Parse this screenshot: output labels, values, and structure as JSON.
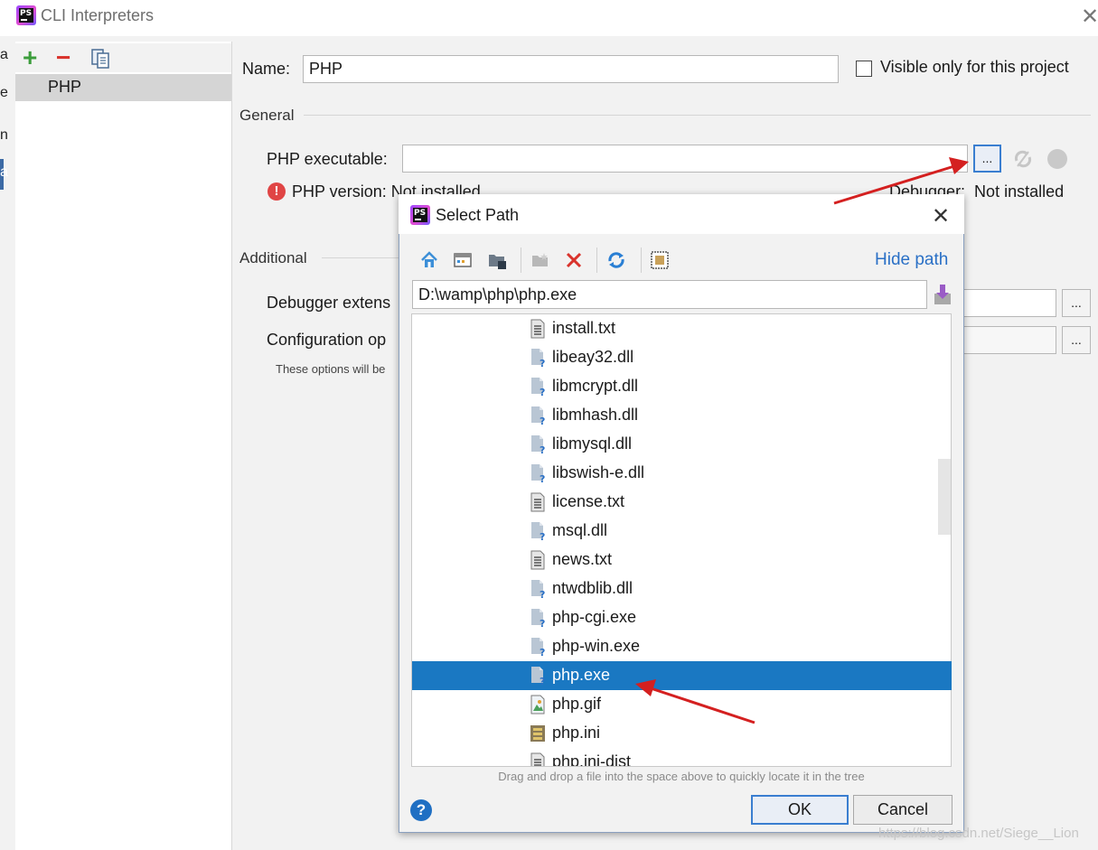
{
  "window": {
    "title": "CLI Interpreters"
  },
  "left_strip": {
    "chars": [
      "a",
      "e",
      "n",
      "a"
    ]
  },
  "sidebar": {
    "items": [
      {
        "label": "PHP"
      }
    ]
  },
  "form": {
    "name_label": "Name:",
    "name_value": "PHP",
    "visible_only_label": "Visible only for this project",
    "general_label": "General",
    "php_executable_label": "PHP executable:",
    "php_executable_value": "",
    "browse_label": "...",
    "php_version_text": "PHP version: Not installed",
    "debugger_text": "Debugger:  Not installed",
    "additional_label": "Additional",
    "debugger_extension_label": "Debugger extens",
    "configuration_options_label": "Configuration op",
    "options_note": "These options will be"
  },
  "dialog": {
    "title": "Select Path",
    "hide_path_label": "Hide path",
    "path_value": "D:\\wamp\\php\\php.exe",
    "files": [
      {
        "name": "install.txt",
        "type": "text"
      },
      {
        "name": "libeay32.dll",
        "type": "unknown"
      },
      {
        "name": "libmcrypt.dll",
        "type": "unknown"
      },
      {
        "name": "libmhash.dll",
        "type": "unknown"
      },
      {
        "name": "libmysql.dll",
        "type": "unknown"
      },
      {
        "name": "libswish-e.dll",
        "type": "unknown"
      },
      {
        "name": "license.txt",
        "type": "text"
      },
      {
        "name": "msql.dll",
        "type": "unknown"
      },
      {
        "name": "news.txt",
        "type": "text"
      },
      {
        "name": "ntwdblib.dll",
        "type": "unknown"
      },
      {
        "name": "php-cgi.exe",
        "type": "unknown"
      },
      {
        "name": "php-win.exe",
        "type": "unknown"
      },
      {
        "name": "php.exe",
        "type": "unknown",
        "selected": true
      },
      {
        "name": "php.gif",
        "type": "image"
      },
      {
        "name": "php.ini",
        "type": "config"
      },
      {
        "name": "php.ini-dist",
        "type": "text"
      }
    ],
    "hint": "Drag and drop a file into the space above to quickly locate it in the tree",
    "ok_label": "OK",
    "cancel_label": "Cancel",
    "help_label": "?"
  },
  "watermark": "https://blog.csdn.net/Siege__Lion",
  "colors": {
    "accent": "#1a78c2",
    "annotation_arrow": "#d42020"
  }
}
